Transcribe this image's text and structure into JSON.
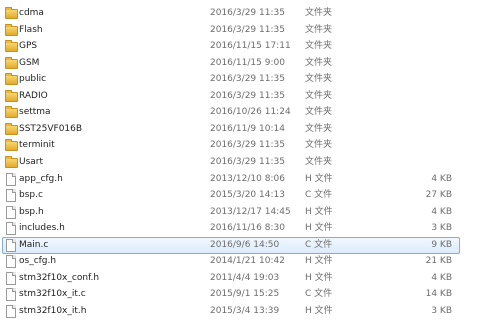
{
  "files": [
    {
      "name": "cdma",
      "modified": "2016/3/29 11:35",
      "type": "文件夹",
      "size": "",
      "icon": "folder-icon",
      "selected": false
    },
    {
      "name": "Flash",
      "modified": "2016/3/29 11:35",
      "type": "文件夹",
      "size": "",
      "icon": "folder-icon",
      "selected": false
    },
    {
      "name": "GPS",
      "modified": "2016/11/15 17:11",
      "type": "文件夹",
      "size": "",
      "icon": "folder-icon",
      "selected": false
    },
    {
      "name": "GSM",
      "modified": "2016/11/15 9:00",
      "type": "文件夹",
      "size": "",
      "icon": "folder-icon",
      "selected": false
    },
    {
      "name": "public",
      "modified": "2016/3/29 11:35",
      "type": "文件夹",
      "size": "",
      "icon": "folder-icon",
      "selected": false
    },
    {
      "name": "RADIO",
      "modified": "2016/3/29 11:35",
      "type": "文件夹",
      "size": "",
      "icon": "folder-icon",
      "selected": false
    },
    {
      "name": "settma",
      "modified": "2016/10/26 11:24",
      "type": "文件夹",
      "size": "",
      "icon": "folder-icon",
      "selected": false
    },
    {
      "name": "SST25VF016B",
      "modified": "2016/11/9 10:14",
      "type": "文件夹",
      "size": "",
      "icon": "folder-icon",
      "selected": false
    },
    {
      "name": "terminit",
      "modified": "2016/3/29 11:35",
      "type": "文件夹",
      "size": "",
      "icon": "folder-icon",
      "selected": false
    },
    {
      "name": "Usart",
      "modified": "2016/3/29 11:35",
      "type": "文件夹",
      "size": "",
      "icon": "folder-icon",
      "selected": false
    },
    {
      "name": "app_cfg.h",
      "modified": "2013/12/10 8:06",
      "type": "H 文件",
      "size": "4 KB",
      "icon": "file-icon",
      "selected": false
    },
    {
      "name": "bsp.c",
      "modified": "2015/3/20 14:13",
      "type": "C 文件",
      "size": "27 KB",
      "icon": "file-icon",
      "selected": false
    },
    {
      "name": "bsp.h",
      "modified": "2013/12/17 14:45",
      "type": "H 文件",
      "size": "4 KB",
      "icon": "file-icon",
      "selected": false
    },
    {
      "name": "includes.h",
      "modified": "2016/11/16 8:30",
      "type": "H 文件",
      "size": "3 KB",
      "icon": "file-icon",
      "selected": false
    },
    {
      "name": "Main.c",
      "modified": "2016/9/6 14:50",
      "type": "C 文件",
      "size": "9 KB",
      "icon": "file-icon",
      "selected": true
    },
    {
      "name": "os_cfg.h",
      "modified": "2014/1/21 10:42",
      "type": "H 文件",
      "size": "21 KB",
      "icon": "file-icon",
      "selected": false
    },
    {
      "name": "stm32f10x_conf.h",
      "modified": "2011/4/4 19:03",
      "type": "H 文件",
      "size": "4 KB",
      "icon": "file-icon",
      "selected": false
    },
    {
      "name": "stm32f10x_it.c",
      "modified": "2015/9/1 15:25",
      "type": "C 文件",
      "size": "14 KB",
      "icon": "file-icon",
      "selected": false
    },
    {
      "name": "stm32f10x_it.h",
      "modified": "2015/3/4 13:39",
      "type": "H 文件",
      "size": "3 KB",
      "icon": "file-icon",
      "selected": false
    }
  ]
}
